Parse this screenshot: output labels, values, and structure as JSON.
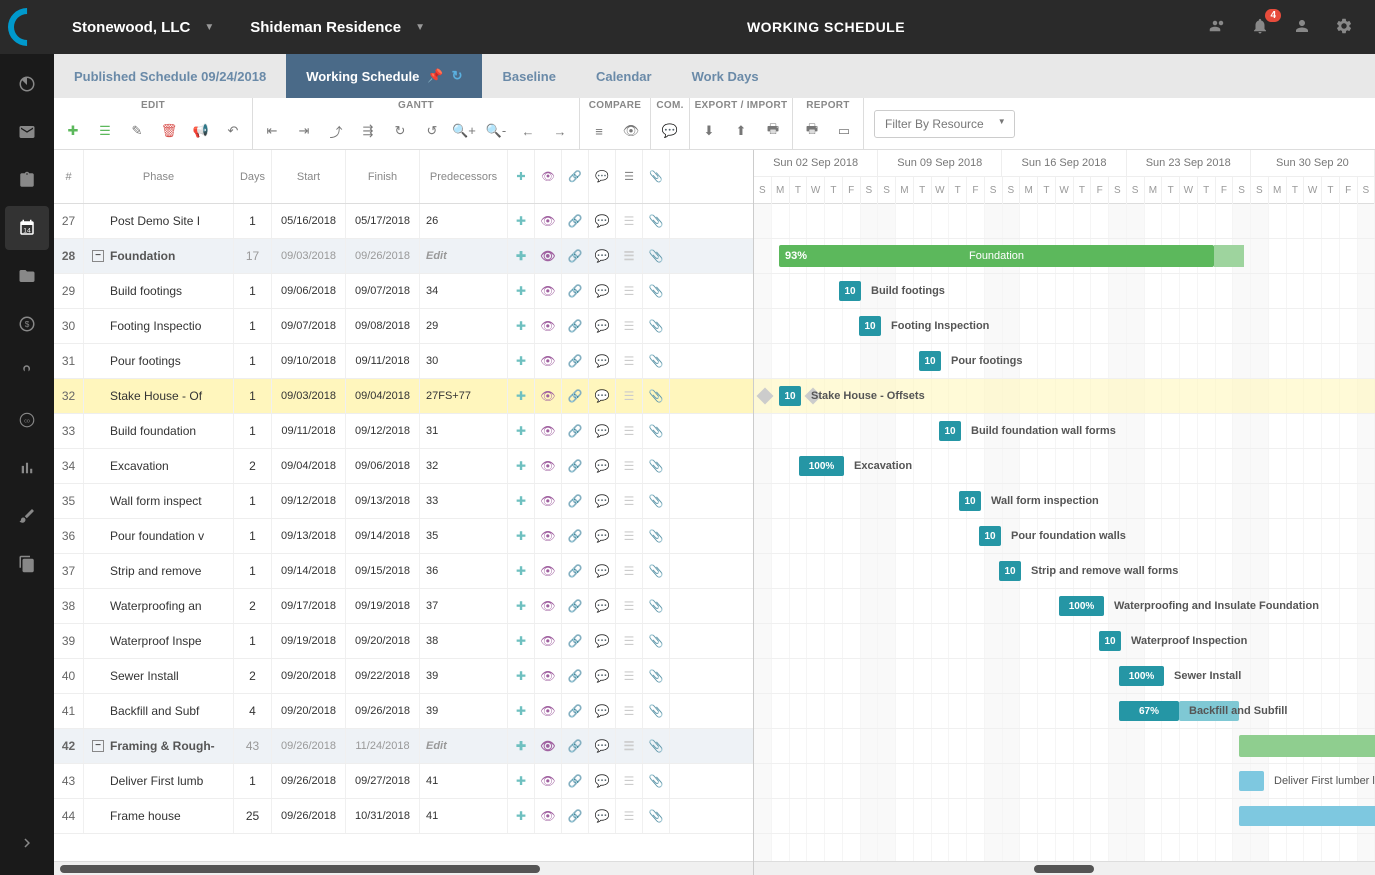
{
  "header": {
    "company": "Stonewood, LLC",
    "project": "Shideman Residence",
    "title": "WORKING SCHEDULE",
    "notif_count": "4"
  },
  "tabs": [
    {
      "label": "Published Schedule 09/24/2018",
      "active": false
    },
    {
      "label": "Working Schedule",
      "active": true
    },
    {
      "label": "Baseline",
      "active": false
    },
    {
      "label": "Calendar",
      "active": false
    },
    {
      "label": "Work Days",
      "active": false
    }
  ],
  "toolbar_groups": {
    "edit": "EDIT",
    "gantt": "GANTT",
    "compare": "COMPARE",
    "com": "COM.",
    "export": "EXPORT / IMPORT",
    "report": "REPORT"
  },
  "filter_placeholder": "Filter By Resource",
  "grid_headers": {
    "num": "#",
    "phase": "Phase",
    "days": "Days",
    "start": "Start",
    "finish": "Finish",
    "pred": "Predecessors"
  },
  "weeks": [
    "Sun 02 Sep 2018",
    "Sun 09 Sep 2018",
    "Sun 16 Sep 2018",
    "Sun 23 Sep 2018",
    "Sun 30 Sep 20"
  ],
  "day_letters": [
    "S",
    "M",
    "T",
    "W",
    "T",
    "F",
    "S"
  ],
  "rows": [
    {
      "num": "27",
      "phase": "Post Demo Site I",
      "days": "1",
      "start": "05/16/2018",
      "finish": "05/17/2018",
      "pred": "26",
      "indent": 1
    },
    {
      "num": "28",
      "phase": "Foundation",
      "days": "17",
      "start": "09/03/2018",
      "finish": "09/26/2018",
      "pred": "Edit",
      "parent": true
    },
    {
      "num": "29",
      "phase": "Build footings",
      "days": "1",
      "start": "09/06/2018",
      "finish": "09/07/2018",
      "pred": "34",
      "indent": 1
    },
    {
      "num": "30",
      "phase": "Footing Inspectio",
      "days": "1",
      "start": "09/07/2018",
      "finish": "09/08/2018",
      "pred": "29",
      "indent": 1
    },
    {
      "num": "31",
      "phase": "Pour footings",
      "days": "1",
      "start": "09/10/2018",
      "finish": "09/11/2018",
      "pred": "30",
      "indent": 1
    },
    {
      "num": "32",
      "phase": "Stake House - Of",
      "days": "1",
      "start": "09/03/2018",
      "finish": "09/04/2018",
      "pred": "27FS+77",
      "indent": 1,
      "selected": true
    },
    {
      "num": "33",
      "phase": "Build foundation ",
      "days": "1",
      "start": "09/11/2018",
      "finish": "09/12/2018",
      "pred": "31",
      "indent": 1
    },
    {
      "num": "34",
      "phase": "Excavation",
      "days": "2",
      "start": "09/04/2018",
      "finish": "09/06/2018",
      "pred": "32",
      "indent": 1
    },
    {
      "num": "35",
      "phase": "Wall form inspect",
      "days": "1",
      "start": "09/12/2018",
      "finish": "09/13/2018",
      "pred": "33",
      "indent": 1
    },
    {
      "num": "36",
      "phase": "Pour foundation v",
      "days": "1",
      "start": "09/13/2018",
      "finish": "09/14/2018",
      "pred": "35",
      "indent": 1
    },
    {
      "num": "37",
      "phase": "Strip and remove",
      "days": "1",
      "start": "09/14/2018",
      "finish": "09/15/2018",
      "pred": "36",
      "indent": 1
    },
    {
      "num": "38",
      "phase": "Waterproofing an",
      "days": "2",
      "start": "09/17/2018",
      "finish": "09/19/2018",
      "pred": "37",
      "indent": 1
    },
    {
      "num": "39",
      "phase": "Waterproof Inspe",
      "days": "1",
      "start": "09/19/2018",
      "finish": "09/20/2018",
      "pred": "38",
      "indent": 1,
      "link_dark": true
    },
    {
      "num": "40",
      "phase": "Sewer Install",
      "days": "2",
      "start": "09/20/2018",
      "finish": "09/22/2018",
      "pred": "39",
      "indent": 1,
      "chat_dark": true
    },
    {
      "num": "41",
      "phase": "Backfill and Subf",
      "days": "4",
      "start": "09/20/2018",
      "finish": "09/26/2018",
      "pred": "39",
      "indent": 1
    },
    {
      "num": "42",
      "phase": "Framing & Rough-",
      "days": "43",
      "start": "09/26/2018",
      "finish": "11/24/2018",
      "pred": "Edit",
      "parent": true
    },
    {
      "num": "43",
      "phase": "Deliver First lumb",
      "days": "1",
      "start": "09/26/2018",
      "finish": "09/27/2018",
      "pred": "41",
      "indent": 1
    },
    {
      "num": "44",
      "phase": "Frame house",
      "days": "25",
      "start": "09/26/2018",
      "finish": "10/31/2018",
      "pred": "41",
      "indent": 1
    }
  ],
  "gantt_bars": {
    "foundation": {
      "pct": "93%",
      "label": "Foundation"
    },
    "build_footings": {
      "pct": "10",
      "label": "Build footings"
    },
    "footing_insp": {
      "pct": "10",
      "label": "Footing Inspection"
    },
    "pour_footings": {
      "pct": "10",
      "label": "Pour footings"
    },
    "stake_house": {
      "pct": "10",
      "label": "Stake House - Offsets"
    },
    "build_found": {
      "pct": "10",
      "label": "Build foundation wall forms"
    },
    "excavation": {
      "pct": "100%",
      "label": "Excavation"
    },
    "wall_form": {
      "pct": "10",
      "label": "Wall form inspection"
    },
    "pour_found": {
      "pct": "10",
      "label": "Pour foundation walls"
    },
    "strip": {
      "pct": "10",
      "label": "Strip and remove wall forms"
    },
    "waterproofing": {
      "pct": "100%",
      "label": "Waterproofing and Insulate Foundation"
    },
    "waterproof_insp": {
      "pct": "10",
      "label": "Waterproof Inspection"
    },
    "sewer": {
      "pct": "100%",
      "label": "Sewer Install"
    },
    "backfill": {
      "pct": "67%",
      "label": "Backfill and Subfill"
    },
    "deliver": {
      "label": "Deliver First lumber load"
    }
  }
}
